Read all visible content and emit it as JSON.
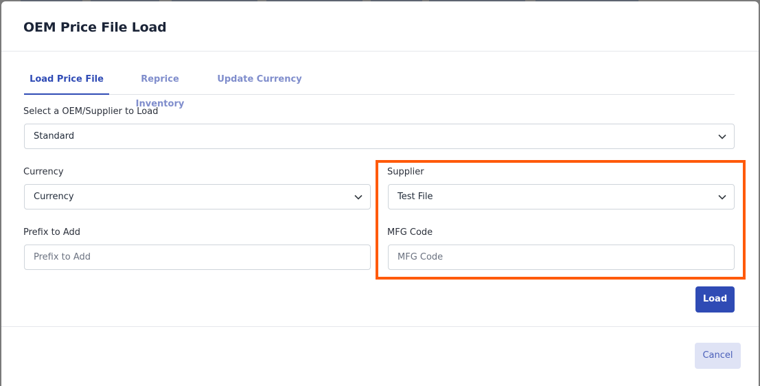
{
  "modal": {
    "title": "OEM Price File Load"
  },
  "tabs": [
    {
      "label": "Load Price File",
      "active": true
    },
    {
      "label": "Reprice Inventory",
      "active": false
    },
    {
      "label": "Update Currency",
      "active": false
    }
  ],
  "form": {
    "oem_supplier": {
      "label": "Select a OEM/Supplier to Load",
      "value": "Standard"
    },
    "currency": {
      "label": "Currency",
      "value": "Currency"
    },
    "supplier": {
      "label": "Supplier",
      "value": "Test File"
    },
    "prefix": {
      "label": "Prefix to Add",
      "placeholder": "Prefix to Add"
    },
    "mfg_code": {
      "label": "MFG Code",
      "placeholder": "MFG Code"
    }
  },
  "buttons": {
    "load": "Load",
    "cancel": "Cancel"
  },
  "colors": {
    "primary": "#2f4bb5",
    "highlight": "#ff5a0a",
    "cancel_bg": "#dfe3f5"
  }
}
